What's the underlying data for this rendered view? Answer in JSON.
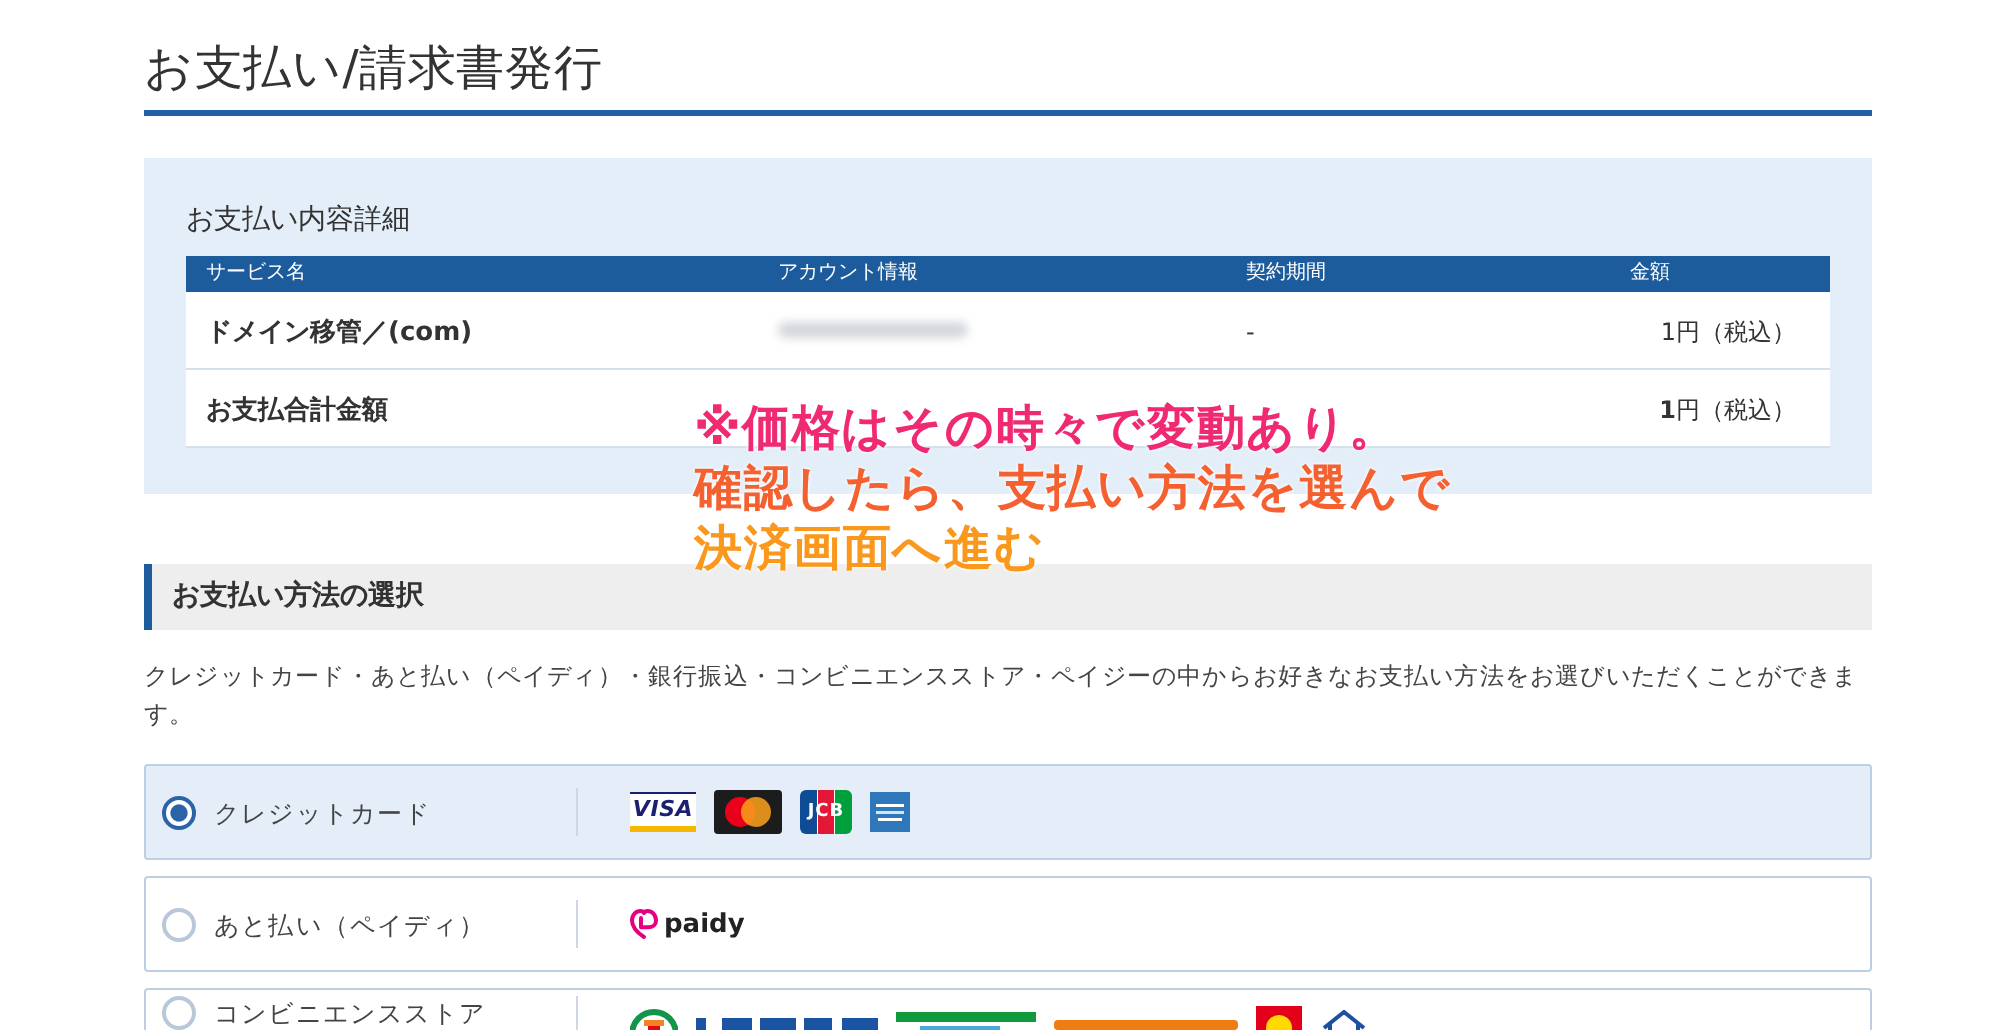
{
  "page": {
    "title": "お支払い/請求書発行"
  },
  "details": {
    "heading": "お支払い内容詳細",
    "columns": [
      "サービス名",
      "アカウント情報",
      "契約期間",
      "金額"
    ],
    "rows": [
      {
        "service": "ドメイン移管／(com)",
        "account_blurred": true,
        "period": "-",
        "amount": "1円（税込）"
      },
      {
        "service": "お支払合計金額",
        "account_blurred": false,
        "amount": "**1**円（税込）"
      }
    ]
  },
  "annotation": {
    "lines": [
      "※価格はその時々で変動あり。",
      "確認したら、支払い方法を選んで",
      "決済画面へ進む"
    ]
  },
  "payment": {
    "heading": "お支払い方法の選択",
    "description": "クレジットカード・あと払い（ペイディ）・銀行振込・コンビニエンスストア・ペイジーの中からお好きなお支払い方法をお選びいただくことができます。",
    "options": [
      {
        "label": "クレジットカード",
        "selected": true,
        "logos": [
          {
            "kind": "visa",
            "text": "VISA"
          },
          {
            "kind": "mastercard"
          },
          {
            "kind": "jcb",
            "text": "JCB"
          },
          {
            "kind": "amex"
          }
        ]
      },
      {
        "label": "あと払い（ペイディ）",
        "selected": false,
        "logos": [
          {
            "kind": "paidy",
            "text": "paidy"
          }
        ]
      },
      {
        "label": "コンビニエンスストア",
        "selected": false,
        "logos": [
          {
            "kind": "seven"
          },
          {
            "kind": "lawson"
          },
          {
            "kind": "family"
          },
          {
            "kind": "seico"
          },
          {
            "kind": "ministop"
          },
          {
            "kind": "yamazaki"
          }
        ]
      }
    ]
  }
}
